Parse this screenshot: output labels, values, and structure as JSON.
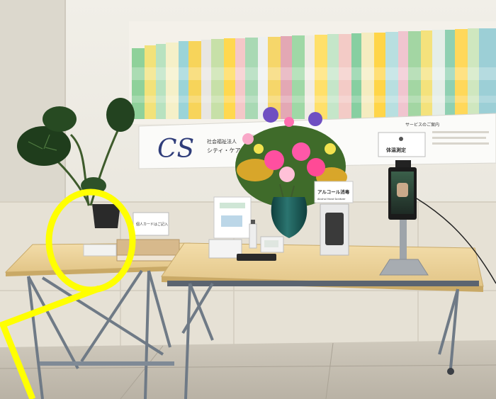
{
  "photo": {
    "wall_panel": {
      "logo_text": "CS",
      "company_small": "社会福祉法人",
      "company_name": "シティ・ケアサービス",
      "service_heading": "サービスのご案内",
      "temp_sign": "体温測定"
    },
    "table_sign_left": "個人カードはご記入",
    "table_sign_alcohol": "アルコール消毒",
    "table_sign_alcohol_en": "Alcohol Hand Sanitizer",
    "annotation": {
      "shape": "magnifier",
      "color": "#ffff00"
    },
    "colors": {
      "wall": "#ece9e0",
      "floor": "#c9c3b6",
      "table_top": "#ecd49c",
      "vase": "#1d5a57",
      "annotation": "#ffff00"
    }
  }
}
